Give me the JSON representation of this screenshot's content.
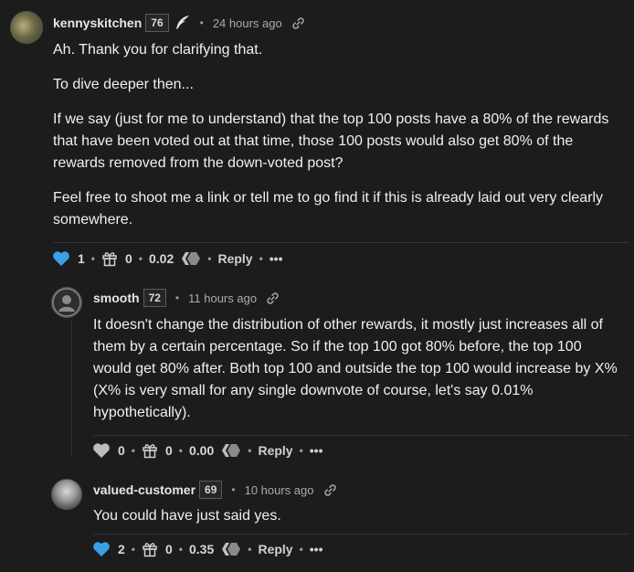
{
  "comments": [
    {
      "author": "kennyskitchen",
      "reputation": "76",
      "time": "24 hours ago",
      "paragraphs": [
        "Ah. Thank you for clarifying that.",
        "To dive deeper then...",
        "If we say (just for me to understand) that the top 100 posts have a 80% of the rewards that have been voted out at that time, those 100 posts would also get 80% of the rewards removed from the down-voted post?",
        "Feel free to shoot me a link or tell me to go find it if this is already laid out very clearly somewhere."
      ],
      "votes": "1",
      "gifts": "0",
      "payout": "0.02",
      "reply_label": "Reply",
      "more_label": "•••",
      "voted": true
    },
    {
      "author": "smooth",
      "reputation": "72",
      "time": "11 hours ago",
      "paragraphs": [
        "It doesn't change the distribution of other rewards, it mostly just increases all of them by a certain percentage. So if the top 100 got 80% before, the top 100 would get 80% after. Both top 100 and outside the top 100 would increase by X% (X% is very small for any single downvote of course, let's say 0.01% hypothetically)."
      ],
      "votes": "0",
      "gifts": "0",
      "payout": "0.00",
      "reply_label": "Reply",
      "more_label": "•••",
      "voted": false
    },
    {
      "author": "valued-customer",
      "reputation": "69",
      "time": "10 hours ago",
      "paragraphs": [
        "You could have just said yes."
      ],
      "votes": "2",
      "gifts": "0",
      "payout": "0.35",
      "reply_label": "Reply",
      "more_label": "•••",
      "voted": true
    }
  ],
  "colors": {
    "background": "#1c1c1c",
    "vote_active": "#3aa0e8",
    "vote_inactive": "#bdbdbd"
  },
  "icons": [
    "quill-icon",
    "link-icon",
    "heart-icon",
    "gift-icon",
    "hive-icon"
  ]
}
